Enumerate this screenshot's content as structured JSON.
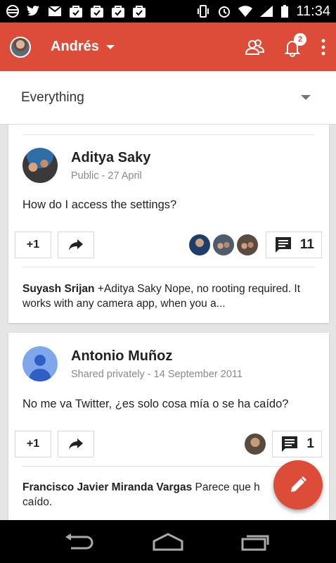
{
  "status_bar": {
    "time": "11:34",
    "icons": [
      "tethering-icon",
      "twitter-icon",
      "gmail-icon",
      "store-update-icon",
      "store-update-icon",
      "store-update-icon",
      "store-update-icon",
      "vibrate-icon",
      "alarm-icon",
      "wifi-icon",
      "signal-icon",
      "battery-icon"
    ]
  },
  "app_bar": {
    "account_name": "Andrés",
    "notification_count": "2",
    "color": "#dd4b39"
  },
  "filter": {
    "selected": "Everything"
  },
  "posts": [
    {
      "author": "Aditya Saky",
      "meta": "Public - 27 April",
      "text": "How do I access the settings?",
      "plus_one": "+1",
      "comment_count": "11",
      "comment_author": "Suyash Srijan",
      "comment_text": " +Aditya Saky Nope, no rooting required. It works with any camera app, when you a..."
    },
    {
      "author": "Antonio Muñoz",
      "meta": "Shared privately - 14 September 2011",
      "text": "No me va Twitter, ¿es solo cosa mía o se ha caído?",
      "plus_one": "+1",
      "comment_count": "1",
      "comment_author": "Francisco Javier Miranda Vargas",
      "comment_text": " Parece que h caído."
    }
  ]
}
